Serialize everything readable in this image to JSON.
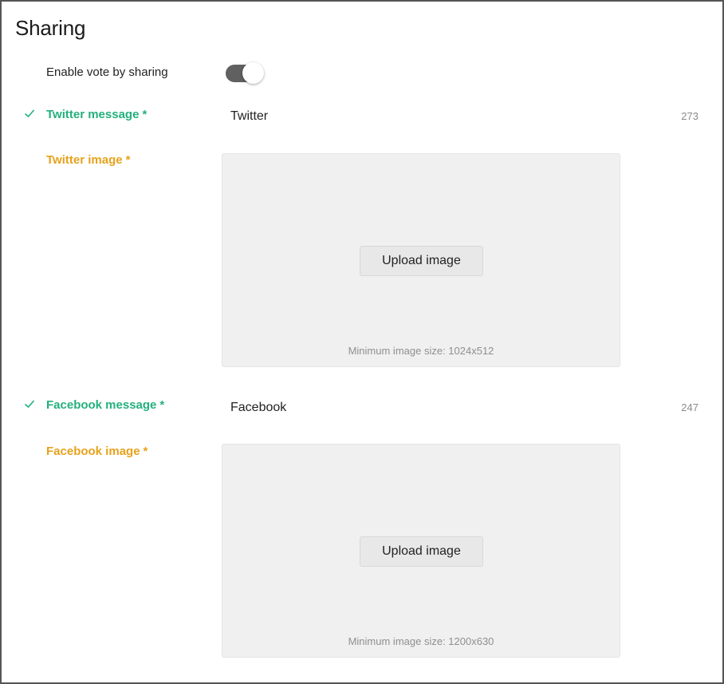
{
  "section": {
    "title": "Sharing"
  },
  "vote_sharing": {
    "label": "Enable vote by sharing",
    "enabled": true
  },
  "twitter": {
    "message_label": "Twitter message",
    "required_mark": "*",
    "message_value": "Twitter",
    "char_count": "273",
    "image_label": "Twitter image",
    "upload_label": "Upload image",
    "min_size_text": "Minimum image size: 1024x512"
  },
  "facebook": {
    "message_label": "Facebook message",
    "required_mark": "*",
    "message_value": "Facebook",
    "char_count": "247",
    "image_label": "Facebook image",
    "upload_label": "Upload image",
    "min_size_text": "Minimum image size: 1200x630"
  },
  "icons": {
    "check": "check-icon"
  },
  "colors": {
    "valid_green": "#23b07d",
    "required_orange": "#e7a21b",
    "toggle_track": "#606060",
    "dropzone_bg": "#f0f0f0"
  }
}
